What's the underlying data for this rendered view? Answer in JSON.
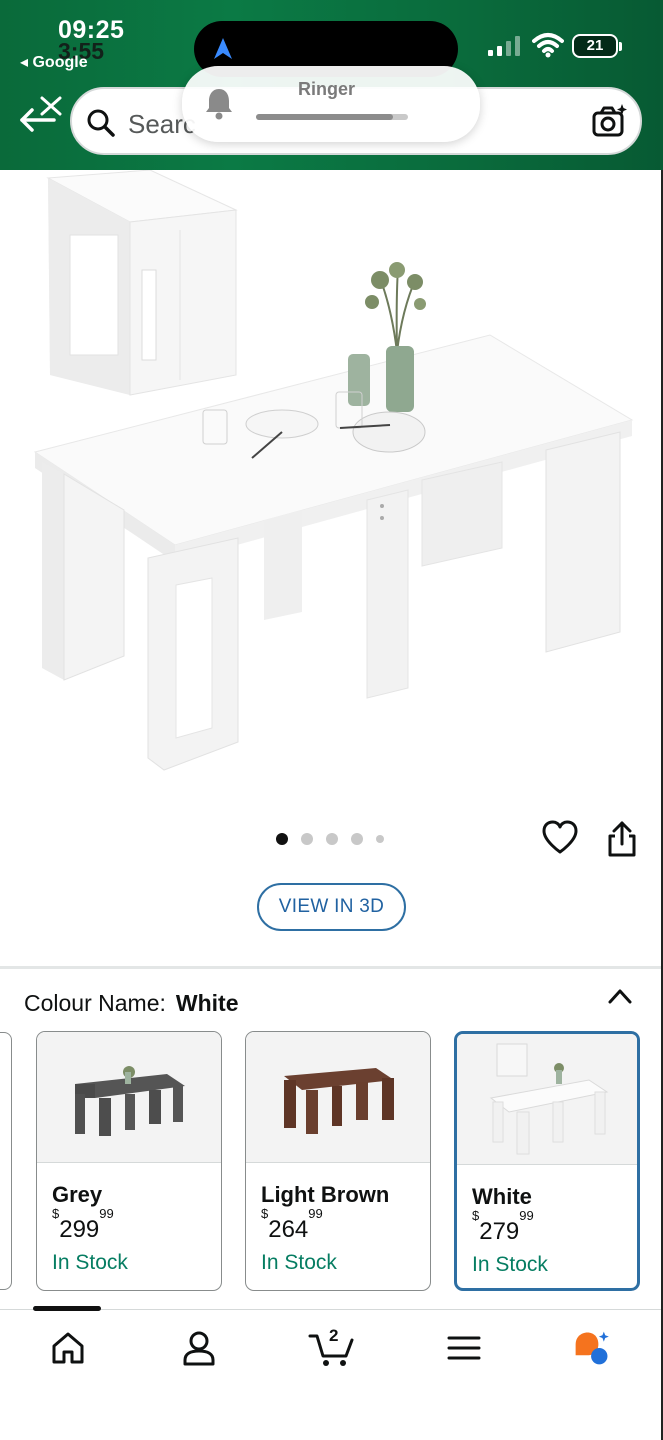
{
  "status_bar": {
    "time": "09:25",
    "time_secondary": "3:55",
    "back_app": "◂ Google",
    "battery": "21"
  },
  "ringer": {
    "label": "Ringer",
    "level": 0.9
  },
  "search": {
    "placeholder": "Searc"
  },
  "gallery": {
    "image_count": 5,
    "active_index": 0
  },
  "view_3d_label": "VIEW IN 3D",
  "colour": {
    "label": "Colour Name:",
    "selected": "White"
  },
  "swatches": [
    {
      "name": "Grey",
      "currency": "$",
      "price_whole": "299",
      "price_fraction": "99",
      "stock": "In Stock"
    },
    {
      "name": "Light Brown",
      "currency": "$",
      "price_whole": "264",
      "price_fraction": "99",
      "stock": "In Stock"
    },
    {
      "name": "White",
      "currency": "$",
      "price_whole": "279",
      "price_fraction": "99",
      "stock": "In Stock"
    }
  ],
  "nav": {
    "cart_count": "2"
  },
  "colors": {
    "header_green": "#0b7a45",
    "link_blue": "#2162a1",
    "stock_green": "#067d62",
    "selected_border": "#2e6fa3"
  }
}
